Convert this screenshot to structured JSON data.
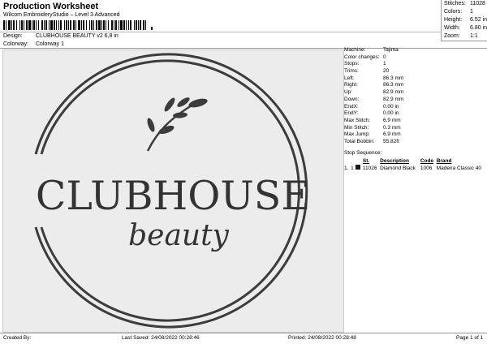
{
  "header": {
    "title": "Production Worksheet",
    "subtitle": "Wilcom EmbroideryStudio – Level 3 Advanced",
    "design_label": "Design:",
    "design_value": "CLUBHOUSE BEAUTY v2 6,8 in",
    "colorway_label": "Colorway:",
    "colorway_value": "Colorway 1"
  },
  "stats": [
    {
      "label": "Stitches:",
      "value": "11028"
    },
    {
      "label": "Colors:",
      "value": "1"
    },
    {
      "label": "Height:",
      "value": "6.52 in"
    },
    {
      "label": "Width:",
      "value": "6.80 in"
    },
    {
      "label": "Zoom:",
      "value": "1:1"
    }
  ],
  "machine_info": [
    {
      "label": "Machine:",
      "value": "Tajima"
    },
    {
      "label": "Color changes:",
      "value": "0"
    },
    {
      "label": "Stops:",
      "value": "1"
    },
    {
      "label": "Trims:",
      "value": "20"
    },
    {
      "label": "Left:",
      "value": "86.3 mm"
    },
    {
      "label": "Right:",
      "value": "86.3 mm"
    },
    {
      "label": "Up:",
      "value": "82.9 mm"
    },
    {
      "label": "Down:",
      "value": "82.9 mm"
    },
    {
      "label": "EndX:",
      "value": "0.00 in"
    },
    {
      "label": "EndY:",
      "value": "0.00 in"
    },
    {
      "label": "Max Stitch:",
      "value": "6.9 mm"
    },
    {
      "label": "Min Stitch:",
      "value": "0.3 mm"
    },
    {
      "label": "Max Jump:",
      "value": "6.9 mm"
    },
    {
      "label": "Total Bobbin:",
      "value": "55.82ft"
    }
  ],
  "stop_sequence": {
    "title": "Stop Sequence:",
    "columns": [
      "",
      "",
      "St.",
      "Description",
      "Code",
      "Brand"
    ],
    "rows": [
      {
        "num": "1.",
        "stop": "1",
        "color": "#1a1a1a",
        "stitches": "11026",
        "description": "Diamond Black",
        "code": "1006",
        "brand": "Madeira Classic 40"
      }
    ]
  },
  "design": {
    "main_text": "CLUBHOUSE",
    "script_text": "beauty"
  },
  "footer": {
    "created_by": "Created By:",
    "last_saved": "Last Saved: 24/08/2022 00:28:46",
    "printed": "Printed: 24/08/2022 00:28:48",
    "page": "Page 1 of 1"
  }
}
